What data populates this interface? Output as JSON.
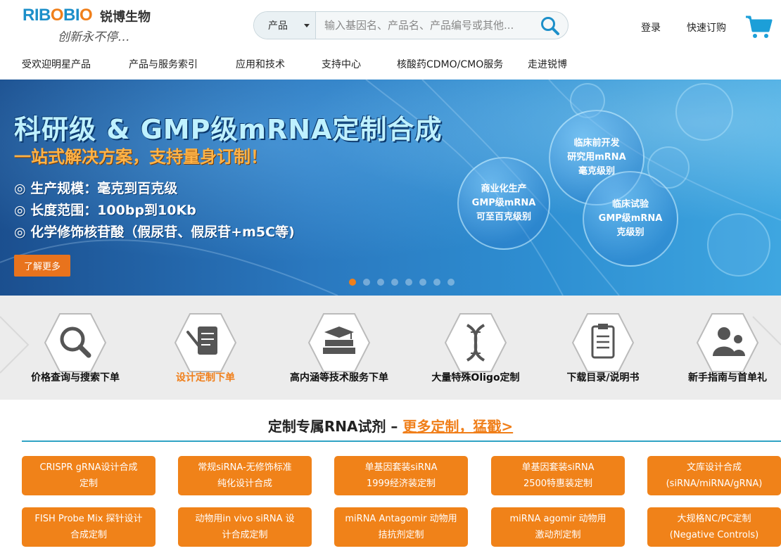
{
  "header": {
    "logo": {
      "brand": "RIBOBIO",
      "cn_name": "锐博生物",
      "slogan": "创新永不停…"
    },
    "search": {
      "category": "产品",
      "placeholder": "输入基因名、产品名、产品编号或其他..."
    },
    "login_label": "登录",
    "quick_order_label": "快速订购",
    "cart_icon": "cart-icon"
  },
  "nav": {
    "items": [
      {
        "label": "受欢迎明星产品"
      },
      {
        "label": "产品与服务索引"
      },
      {
        "label": "应用和技术"
      },
      {
        "label": "支持中心"
      },
      {
        "label": "核酸药CDMO/CMO服务"
      },
      {
        "label": "走进锐博"
      }
    ]
  },
  "banner": {
    "title": "科研级 & GMP级mRNA定制合成",
    "subtitle": "一站式解决方案，支持量身订制！",
    "bullets": [
      "◎ 生产规模：毫克到百克级",
      "◎ 长度范围：100bp到10Kb",
      "◎ 化学修饰核苷酸（假尿苷、假尿苷+m5C等)"
    ],
    "button_label": "了解更多",
    "bubbles": [
      {
        "line1": "临床前开发",
        "line2": "研究用mRNA",
        "line3": "毫克级别"
      },
      {
        "line1": "商业化生产",
        "line2": "GMP级mRNA",
        "line3": "可至百克级别"
      },
      {
        "line1": "临床试验",
        "line2": "GMP级mRNA",
        "line3": "克级别"
      }
    ],
    "slide_count": 8,
    "active_slide": 1,
    "accent_color": "#f07f1a"
  },
  "quick_links": [
    {
      "label": "价格查询与搜索下单",
      "icon": "search-icon"
    },
    {
      "label": "设计定制下单",
      "icon": "design-icon"
    },
    {
      "label": "高内涵等技术服务下单",
      "icon": "books-icon"
    },
    {
      "label": "大量特殊Oligo定制",
      "icon": "dna-icon"
    },
    {
      "label": "下载目录/说明书",
      "icon": "clipboard-icon"
    },
    {
      "label": "新手指南与首单礼",
      "icon": "users-icon"
    }
  ],
  "section": {
    "title": "定制专属RNA试剂 – ",
    "more_label": "更多定制，猛戳>"
  },
  "products": [
    {
      "line1": "CRISPR gRNA设计合成",
      "line2": "定制"
    },
    {
      "line1": "常规siRNA-无修饰标准",
      "line2": "纯化设计合成"
    },
    {
      "line1": "单基因套装siRNA",
      "line2": "1999经济装定制"
    },
    {
      "line1": "单基因套装siRNA",
      "line2": "2500特惠装定制"
    },
    {
      "line1": "文库设计合成",
      "line2": "(siRNA/miRNA/gRNA)"
    },
    {
      "line1": "FISH Probe Mix 探针设计",
      "line2": "合成定制"
    },
    {
      "line1": "动物用in vivo siRNA 设",
      "line2": "计合成定制"
    },
    {
      "line1": "miRNA Antagomir 动物用",
      "line2": "拮抗剂定制"
    },
    {
      "line1": "miRNA agomir 动物用",
      "line2": "激动剂定制"
    },
    {
      "line1": "大规格NC/PC定制",
      "line2": "(Negative Controls)"
    }
  ],
  "colors": {
    "brand_blue": "#1c8fc9",
    "brand_orange": "#f07f1a",
    "divider_teal": "#2fa3c4"
  }
}
